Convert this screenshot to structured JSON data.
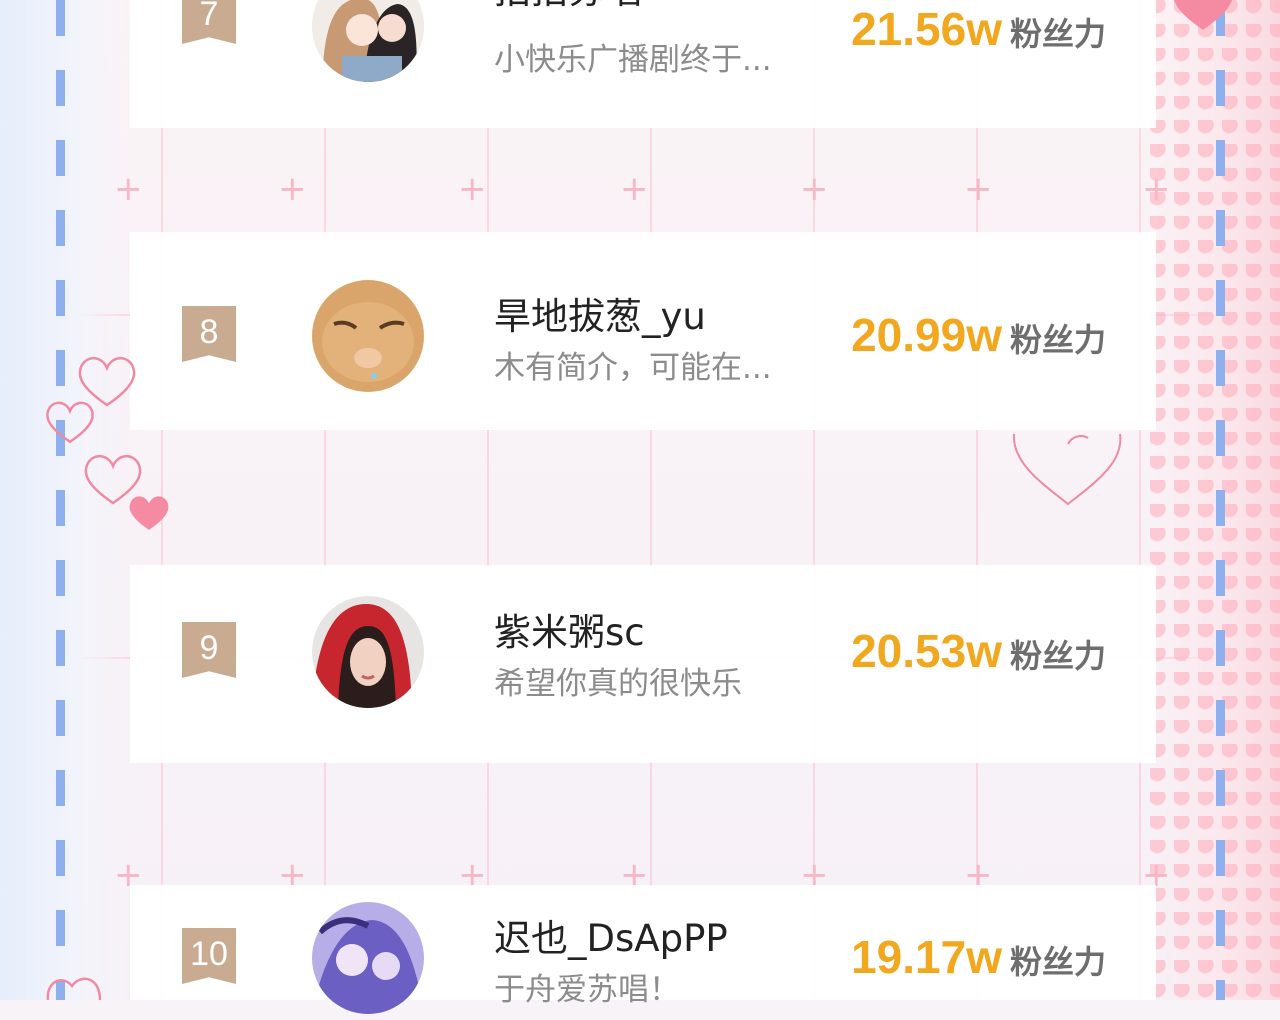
{
  "list": [
    {
      "rank": "7",
      "name": "拍拍苏唱",
      "desc": "小快乐广播剧终于...",
      "value": "21.56w",
      "unit": "粉丝力",
      "avatar": "anime-girls-avatar"
    },
    {
      "rank": "8",
      "name": "旱地拔葱_yu",
      "desc": "木有简介，可能在...",
      "value": "20.99w",
      "unit": "粉丝力",
      "avatar": "cat-avatar"
    },
    {
      "rank": "9",
      "name": "紫米粥sc",
      "desc": "希望你真的很快乐",
      "value": "20.53w",
      "unit": "粉丝力",
      "avatar": "red-hood-girl-avatar"
    },
    {
      "rank": "10",
      "name": "迟也_DsApPP",
      "desc": "于舟爱苏唱！",
      "value": "19.17w",
      "unit": "粉丝力",
      "avatar": "purple-anime-avatar"
    }
  ],
  "colors": {
    "rank_badge": "#c9ab91",
    "score": "#f2a81e",
    "accent_pink": "#f28ba3",
    "dash_blue": "#8fb0ee"
  }
}
